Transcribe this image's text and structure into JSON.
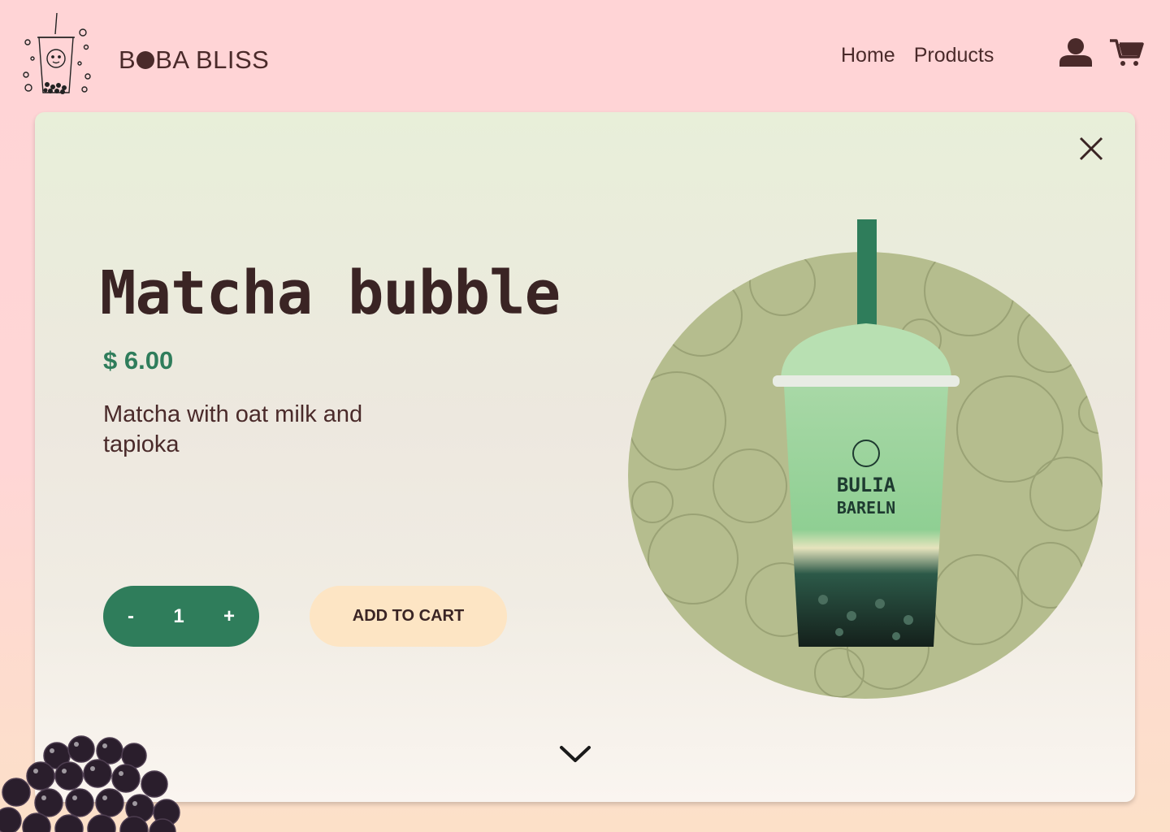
{
  "header": {
    "brand_prefix": "B",
    "brand_suffix": "BA BLISS",
    "logo_icon": "boba-cup-logo-icon",
    "nav": [
      {
        "label": "Home"
      },
      {
        "label": "Products"
      }
    ],
    "user_icon": "user-icon",
    "cart_icon": "cart-icon"
  },
  "product": {
    "title": "Matcha bubble",
    "price": "$ 6.00",
    "description": "Matcha with oat milk and tapioka",
    "quantity": "1",
    "decrement_label": "-",
    "increment_label": "+",
    "add_to_cart_label": "ADD TO CART",
    "cup_text_line1": "BULIA",
    "cup_text_line2": "BARELN"
  },
  "colors": {
    "accent_green": "#2f7d5b",
    "button_cream": "#fde5c4",
    "text_brown": "#4a2a2a",
    "bg_pink": "#ffd4d6",
    "circle_green": "#b5bd8e"
  }
}
